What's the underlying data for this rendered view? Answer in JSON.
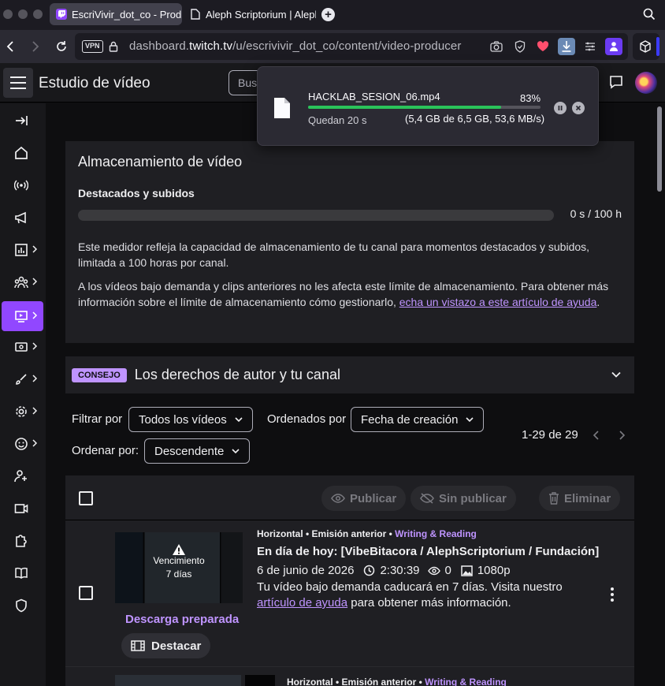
{
  "browser": {
    "tabs": [
      {
        "title": "EscriVivir_dot_co - Prod",
        "active": true
      },
      {
        "title": "Aleph Scriptorium | Aleph",
        "active": false
      }
    ],
    "vpn_label": "VPN",
    "url_prefix": "dashboard.",
    "url_domain": "twitch.tv",
    "url_path": "/u/escrivivir_dot_co/content/video-producer"
  },
  "header": {
    "title": "Estudio de vídeo",
    "search_placeholder": "Buscar"
  },
  "download": {
    "filename": "HACKLAB_SESION_06.mp4",
    "percent_label": "83%",
    "progress": 0.83,
    "time_left": "Quedan 20 s",
    "size_info": "(5,4 GB de 6,5 GB, 53,6 MB/s)"
  },
  "storage": {
    "title": "Almacenamiento de vídeo",
    "subtitle": "Destacados y subidos",
    "usage": "0 s / 100 h",
    "usage_fraction": 0,
    "para1": "Este medidor refleja la capacidad de almacenamiento de tu canal para momentos destacados y subidos, limitada a 100 horas por canal.",
    "para2_text": "A los vídeos bajo demanda y clips anteriores no les afecta este límite de almacenamiento. Para obtener más información sobre el límite de almacenamiento cómo gestionarlo, ",
    "para2_link": "echa un vistazo a este artículo de ayuda",
    "para2_end": "."
  },
  "tip": {
    "badge": "CONSEJO",
    "title": "Los derechos de autor y tu canal"
  },
  "filters": {
    "filter_label": "Filtrar por",
    "filter_value": "Todos los vídeos",
    "sort_label": "Ordenados por",
    "sort_value": "Fecha de creación",
    "order_label": "Ordenar por:",
    "order_value": "Descendente",
    "pager": "1-29 de 29"
  },
  "actions": {
    "publish": "Publicar",
    "unpublish": "Sin publicar",
    "delete": "Eliminar"
  },
  "videos": [
    {
      "format": "Horizontal",
      "type": "Emisión anterior",
      "category": "Writing & Reading",
      "title": "En día de hoy: [VibeBitacora / AlephScriptorium / Fundación]",
      "date": "6 de junio de 2026",
      "duration": "2:30:39",
      "views": "0",
      "quality": "1080p",
      "desc_text": "Tu vídeo bajo demanda caducará en 7 días. Visita nuestro ",
      "desc_link": "artículo de ayuda",
      "desc_end": " para obtener más información.",
      "expiry_line1": "Vencimiento",
      "expiry_line2": "7 días",
      "ready_label": "Descarga preparada",
      "highlight_label": "Destacar"
    },
    {
      "format": "Horizontal",
      "type": "Emisión anterior",
      "category": "Writing & Reading"
    }
  ]
}
